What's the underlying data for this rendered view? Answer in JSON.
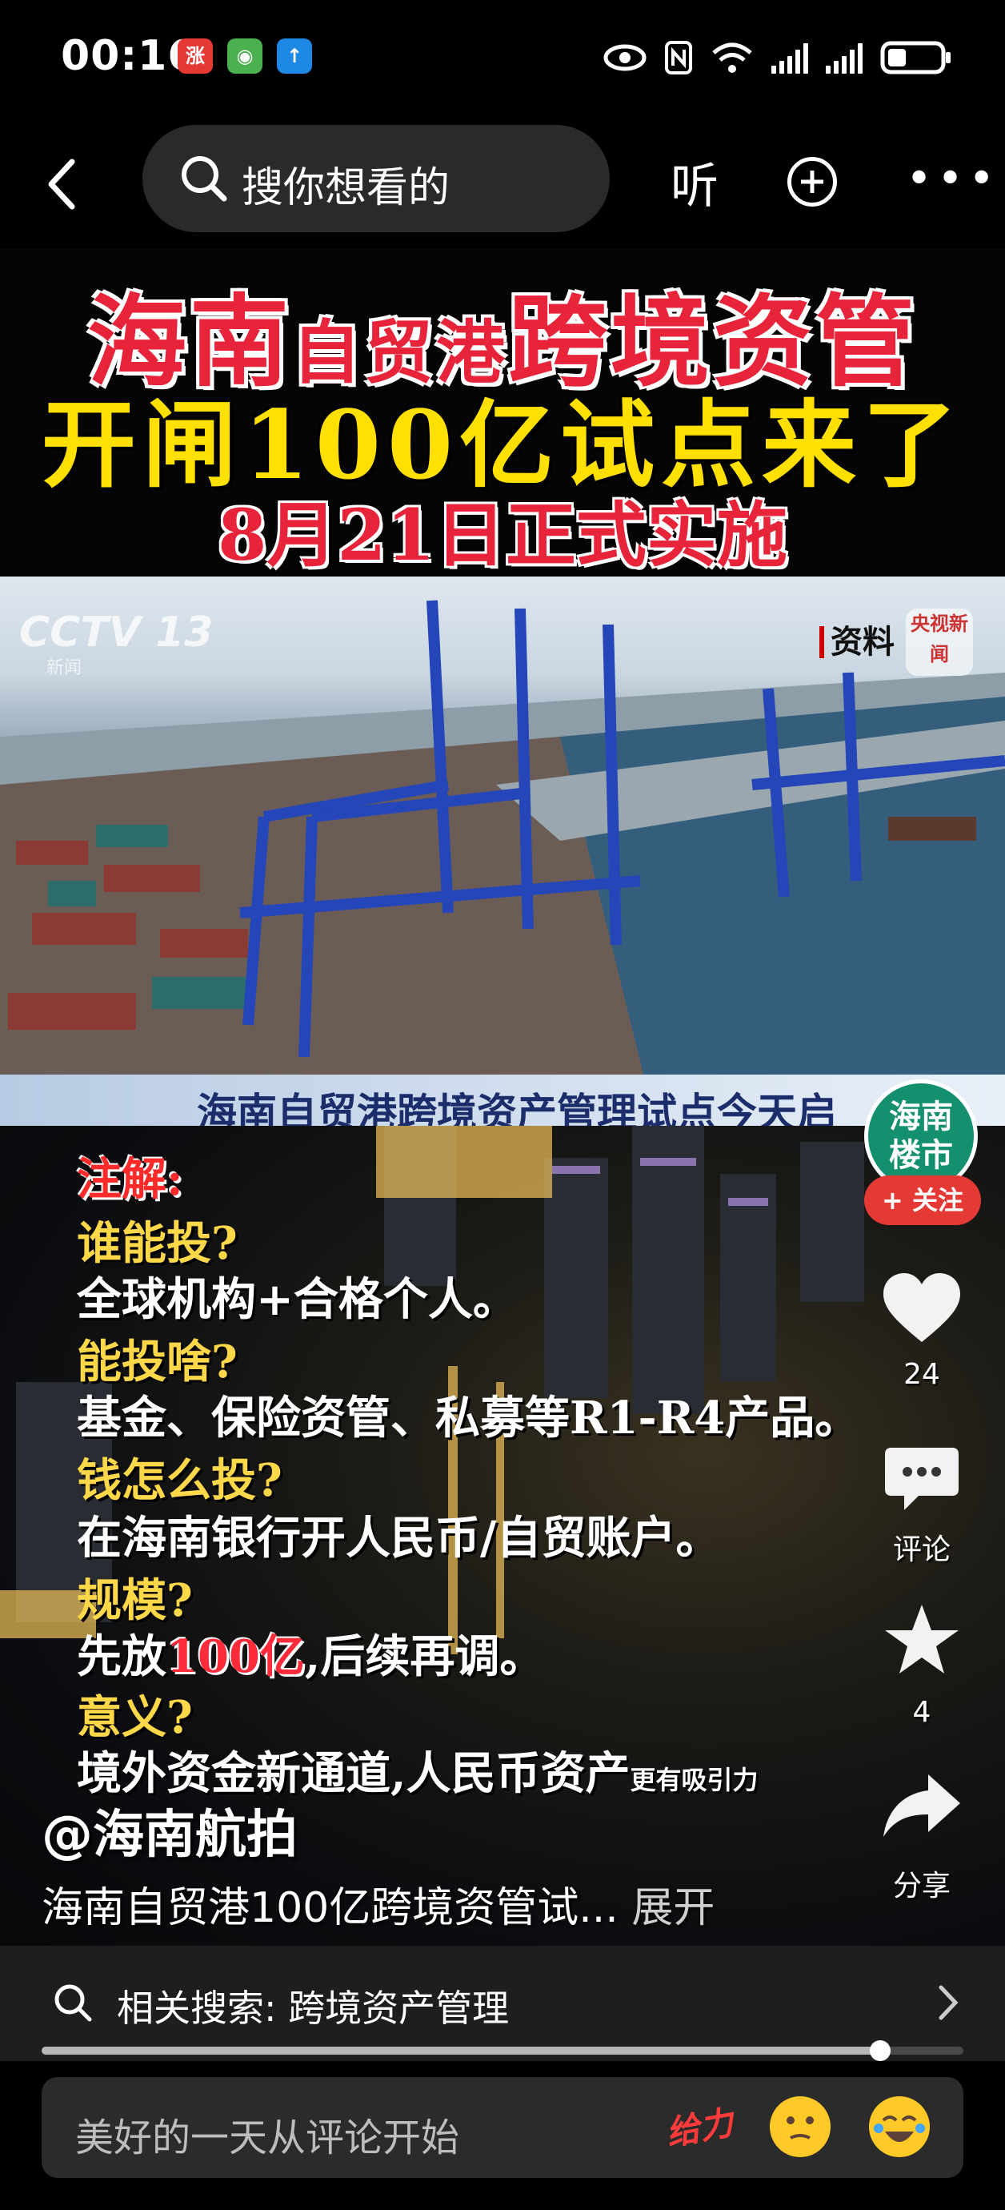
{
  "status_bar": {
    "time": "00:16",
    "app_icons": [
      "涨",
      "app",
      "↑"
    ]
  },
  "top_nav": {
    "search_placeholder": "搜你想看的",
    "listen_label": "听"
  },
  "banner": {
    "line1_a": "海南",
    "line1_b": "自贸港",
    "line1_c": "跨境资管",
    "line2": "开闸100亿试点来了",
    "line3": "8月21日正式实施"
  },
  "video": {
    "channel_logo": "CCTV 13",
    "channel_sub": "新闻",
    "source_tag": "资料",
    "news_badge": "央视新闻",
    "ticker": "海南自贸港跨境资产管理试点今天启"
  },
  "notes": {
    "header": "注解:",
    "q1": "谁能投?",
    "a1": "全球机构+合格个人。",
    "q2": "能投啥?",
    "a2": "基金、保险资管、私募等R1-R4产品。",
    "q3": "钱怎么投?",
    "a3": "在海南银行开人民币/自贸账户。",
    "q4": "规模?",
    "a4_pre": "先放",
    "a4_highlight": "100亿",
    "a4_post": ",后续再调。",
    "q5": "意义?",
    "a5_main": "境外资金新通道,人民币资产",
    "a5_tail": "更有吸引力"
  },
  "creator": {
    "avatar_text": "海南\n楼市",
    "follow_label": "+ 关注",
    "handle": "@海南航拍"
  },
  "actions": {
    "likes": "24",
    "comment_label": "评论",
    "favorites": "4",
    "share_label": "分享"
  },
  "caption": {
    "text": "海南自贸港100亿跨境资管试...",
    "expand": "展开"
  },
  "related": {
    "label": "相关搜索: ",
    "query": "跨境资产管理"
  },
  "playback": {
    "progress": 0.91
  },
  "comment_bar": {
    "placeholder": "美好的一天从评论开始",
    "gift_label": "给力"
  }
}
